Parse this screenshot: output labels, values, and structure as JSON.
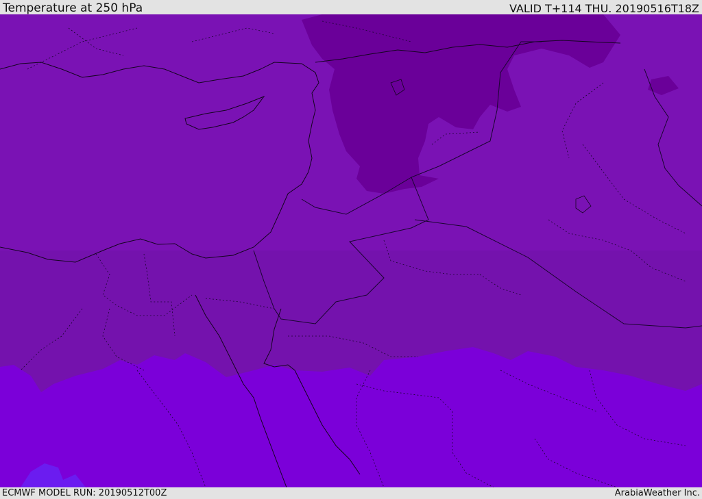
{
  "header": {
    "title": "Temperature at 250 hPa",
    "valid_time": "VALID T+114 THU. 20190516T18Z"
  },
  "footer": {
    "model_run": "ECMWF MODEL RUN: 20190512T00Z",
    "credit": "ArabiaWeather Inc."
  },
  "colors": {
    "band_cold": "#6a0099",
    "band_mid": "#7a12b4",
    "band_mid_south": "#7412ad",
    "band_warm": "#7b00d9",
    "band_warmest": "#6b1cf0",
    "border_line": "#1a0530",
    "coast_line": "#14041f"
  }
}
